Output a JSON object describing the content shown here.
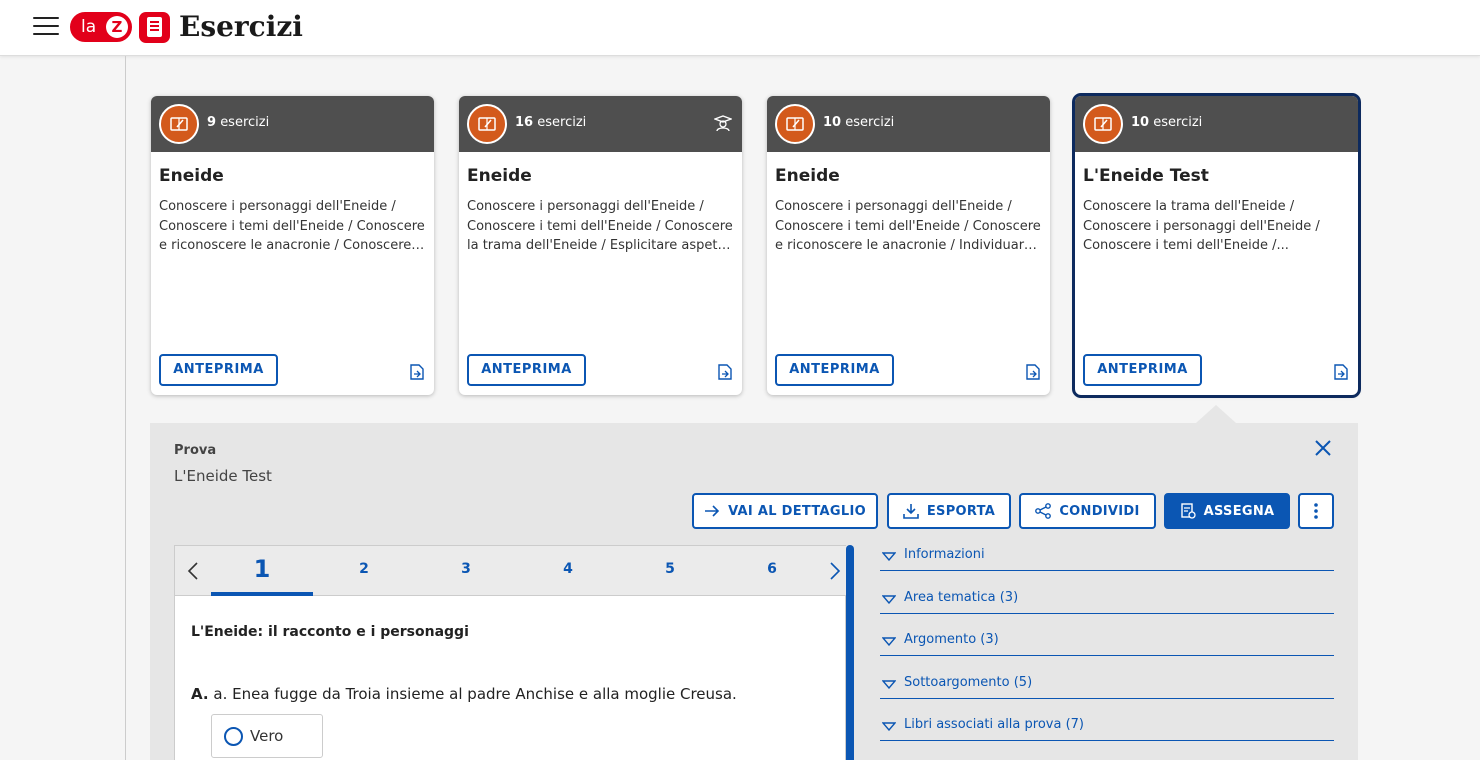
{
  "header": {
    "logo_text_la": "la",
    "logo_text_z": "Z",
    "title": "Esercizi"
  },
  "cards": [
    {
      "count": "9",
      "count_label": "esercizi",
      "title": "Eneide",
      "description": "Conoscere i personaggi dell'Eneide / Conoscere i temi dell'Eneide / Conoscere e riconoscere le anacronie / Conoscere la trama dell'Eneide",
      "preview_label": "ANTEPRIMA",
      "teacher_icon": false
    },
    {
      "count": "16",
      "count_label": "esercizi",
      "title": "Eneide",
      "description": "Conoscere i personaggi dell'Eneide / Conoscere i temi dell'Eneide / Conoscere la trama dell'Eneide / Esplicitare aspetti del testo",
      "preview_label": "ANTEPRIMA",
      "teacher_icon": true
    },
    {
      "count": "10",
      "count_label": "esercizi",
      "title": "Eneide",
      "description": "Conoscere i personaggi dell'Eneide / Conoscere i temi dell'Eneide / Conoscere e riconoscere le anacronie / Individuare informazioni",
      "preview_label": "ANTEPRIMA",
      "teacher_icon": false
    },
    {
      "count": "10",
      "count_label": "esercizi",
      "title": "L'Eneide Test",
      "description": "Conoscere la trama dell'Eneide / Conoscere i personaggi dell'Eneide / Conoscere i temi dell'Eneide /...",
      "preview_label": "ANTEPRIMA",
      "teacher_icon": false,
      "selected": true
    }
  ],
  "panel": {
    "label": "Prova",
    "name": "L'Eneide Test",
    "actions": {
      "detail": "VAI AL DETTAGLIO",
      "export": "ESPORTA",
      "share": "CONDIVIDI",
      "assign": "ASSEGNA"
    }
  },
  "question": {
    "tabs": [
      "1",
      "2",
      "3",
      "4",
      "5",
      "6"
    ],
    "active_tab": "1",
    "title": "L'Eneide: il racconto e i personaggi",
    "item_letter": "A.",
    "item_text": "a. Enea fugge da Troia insieme al padre Anchise e alla moglie Creusa.",
    "option_true": "Vero"
  },
  "accordion": [
    "Informazioni",
    "Area tematica (3)",
    "Argomento (3)",
    "Sottoargomento (5)",
    "Libri associati alla prova (7)"
  ],
  "colors": {
    "accent": "#0b56b3",
    "card_header": "#4f4f4f",
    "badge": "#d35a1c",
    "brand_red": "#e2001a"
  }
}
